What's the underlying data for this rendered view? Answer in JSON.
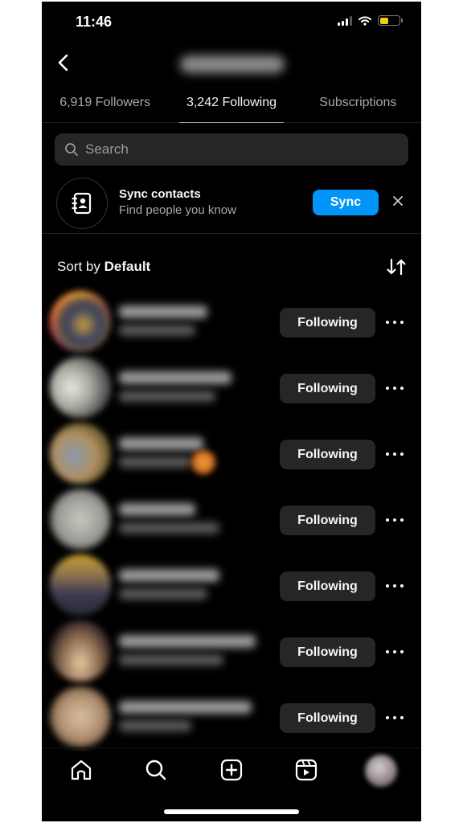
{
  "status_bar": {
    "time": "11:46",
    "battery_level": 0.45,
    "battery_color": "#f5d000",
    "icons": [
      "cellular-signal-icon",
      "wifi-icon",
      "battery-icon"
    ]
  },
  "header": {
    "back_icon": "chevron-left-icon",
    "title_blurred": true
  },
  "tabs": [
    {
      "label": "6,919 Followers",
      "active": false
    },
    {
      "label": "3,242 Following",
      "active": true
    },
    {
      "label": "Subscriptions",
      "active": false
    }
  ],
  "search": {
    "placeholder": "Search",
    "value": "",
    "icon": "search-icon"
  },
  "sync_contacts": {
    "icon": "contact-book-icon",
    "title": "Sync contacts",
    "subtitle": "Find people you know",
    "button_label": "Sync",
    "button_color": "#0095f6",
    "dismiss_icon": "close-icon"
  },
  "sort": {
    "prefix": "Sort by",
    "value": "Default",
    "icon": "sort-arrows-icon"
  },
  "following_list": [
    {
      "username_blurred": true,
      "button_label": "Following",
      "story_ring": true
    },
    {
      "username_blurred": true,
      "button_label": "Following",
      "story_ring": false
    },
    {
      "username_blurred": true,
      "button_label": "Following",
      "story_ring": false
    },
    {
      "username_blurred": true,
      "button_label": "Following",
      "story_ring": false
    },
    {
      "username_blurred": true,
      "button_label": "Following",
      "story_ring": false
    },
    {
      "username_blurred": true,
      "button_label": "Following",
      "story_ring": false
    },
    {
      "username_blurred": true,
      "button_label": "Following",
      "story_ring": false
    }
  ],
  "bottom_nav": [
    {
      "icon": "home-icon"
    },
    {
      "icon": "search-icon"
    },
    {
      "icon": "create-post-icon"
    },
    {
      "icon": "reels-icon"
    },
    {
      "icon": "profile-avatar"
    }
  ]
}
